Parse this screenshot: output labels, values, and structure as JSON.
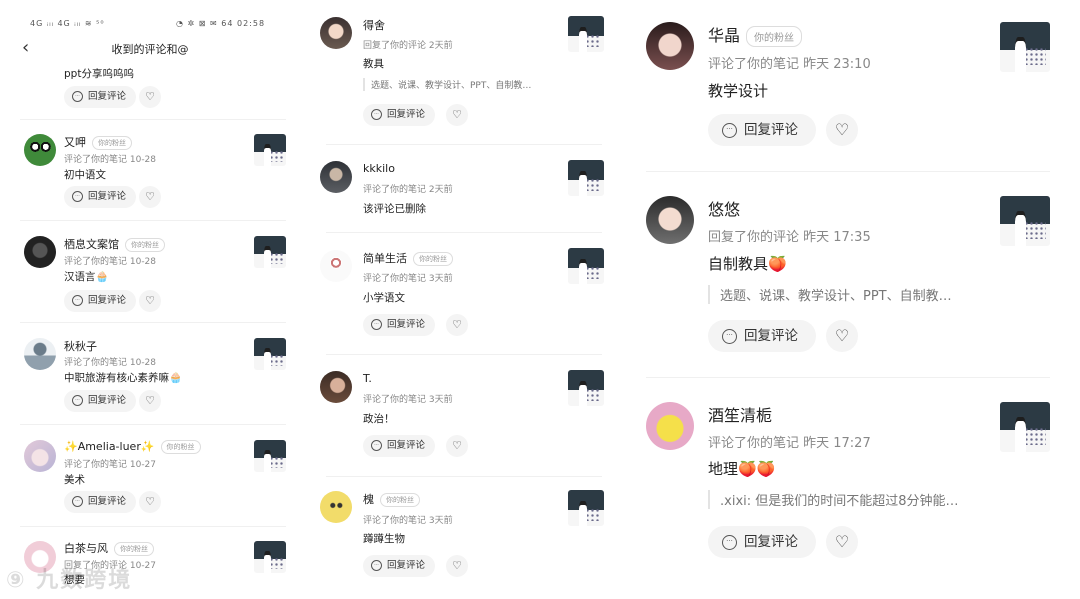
{
  "statusbar": {
    "left_text": "4G ᵢₗₗ 4G ᵢₗₗ ≋ ⁵⁰",
    "right_text": "◔ ✲ ⊠ ✉ 64 02:58"
  },
  "header": {
    "title": "收到的评论和@",
    "back_icon": "‹"
  },
  "reply_label": "回复评论",
  "like_icon": "♡",
  "fan_badge": "你的粉丝",
  "panel1": {
    "partial": {
      "content": "ppt分享呜呜呜"
    },
    "items": [
      {
        "name": "又呷",
        "fan": true,
        "meta": "评论了你的笔记  10-28",
        "content": "初中语文"
      },
      {
        "name": "栖息文案馆",
        "fan": true,
        "meta": "评论了你的笔记  10-28",
        "content": "汉语言🧁"
      },
      {
        "name": "秋秋子",
        "fan": false,
        "meta": "评论了你的笔记  10-28",
        "content": "中职旅游有核心素养嘛🧁"
      },
      {
        "name": "✨Amelia-luer✨",
        "fan": true,
        "meta": "评论了你的笔记  10-27",
        "content": "美术"
      },
      {
        "name": "白茶与风",
        "fan": true,
        "meta": "回复了你的评论  10-27",
        "content": "想要"
      }
    ]
  },
  "panel2": {
    "items": [
      {
        "name": "得舍",
        "fan": false,
        "meta": "回复了你的评论  2天前",
        "content": "教具",
        "quote": "选题、说课、教学设计、PPT、自制教…"
      },
      {
        "name": "kkkilo",
        "fan": false,
        "meta": "评论了你的笔记  2天前",
        "content": "该评论已删除",
        "quote": ""
      },
      {
        "name": "简单生活",
        "fan": true,
        "meta": "评论了你的笔记  3天前",
        "content": "小学语文",
        "quote": ""
      },
      {
        "name": "T.",
        "fan": false,
        "meta": "评论了你的笔记  3天前",
        "content": "政治！",
        "quote": ""
      },
      {
        "name": "槐",
        "fan": true,
        "meta": "评论了你的笔记  3天前",
        "content": "蹲蹲生物",
        "quote": ""
      }
    ]
  },
  "panel3": {
    "items": [
      {
        "name": "华晶",
        "fan": true,
        "meta": "评论了你的笔记  昨天 23:10",
        "content": "教学设计",
        "quote": ""
      },
      {
        "name": "悠悠",
        "fan": false,
        "meta": "回复了你的评论  昨天 17:35",
        "content": "自制教具🍑",
        "quote": "选题、说课、教学设计、PPT、自制教…"
      },
      {
        "name": "酒笙清栀",
        "fan": false,
        "meta": "评论了你的笔记  昨天 17:27",
        "content": "地理🍑🍑",
        "quote": ".xixi: 但是我们的时间不能超过8分钟能…"
      }
    ]
  },
  "watermark": "⑨ 九数跨境",
  "colors": {
    "button_bg": "#f4f4f4",
    "meta": "#888888",
    "badge_border": "#dddddd"
  }
}
